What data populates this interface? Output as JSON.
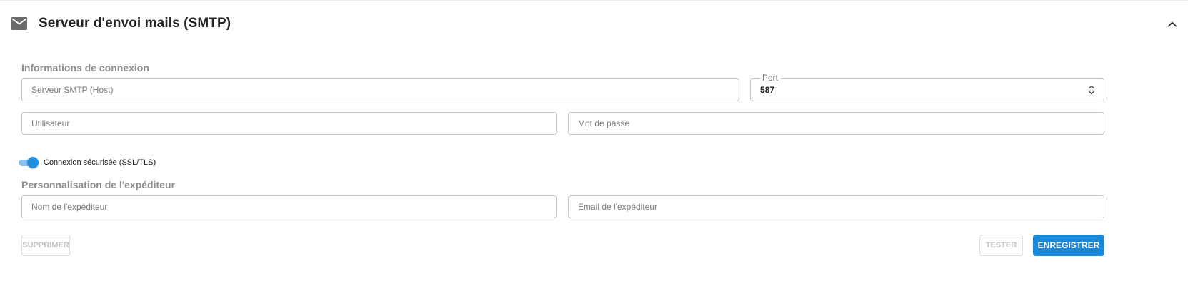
{
  "header": {
    "title": "Serveur d'envoi mails (SMTP)",
    "icon": "mail-icon",
    "collapse_icon": "chevron-up-icon"
  },
  "connection": {
    "section_title": "Informations de connexion",
    "host_placeholder": "Serveur SMTP (Host)",
    "host_value": "",
    "port_label": "Port",
    "port_value": "587",
    "user_placeholder": "Utilisateur",
    "user_value": "",
    "password_placeholder": "Mot de passe",
    "password_value": "",
    "secure_toggle_label": "Connexion sécurisée (SSL/TLS)",
    "secure_toggle_on": true
  },
  "sender": {
    "section_title": "Personnalisation de l'expéditeur",
    "name_placeholder": "Nom de l'expéditeur",
    "name_value": "",
    "email_placeholder": "Email de l'expéditeur",
    "email_value": ""
  },
  "actions": {
    "delete_label": "SUPPRIMER",
    "delete_disabled": true,
    "test_label": "TESTER",
    "test_disabled": true,
    "save_label": "ENREGISTRER"
  },
  "colors": {
    "accent": "#1c88d8",
    "toggle_track": "#8bc4ec",
    "section_title": "#8e8e8e"
  }
}
